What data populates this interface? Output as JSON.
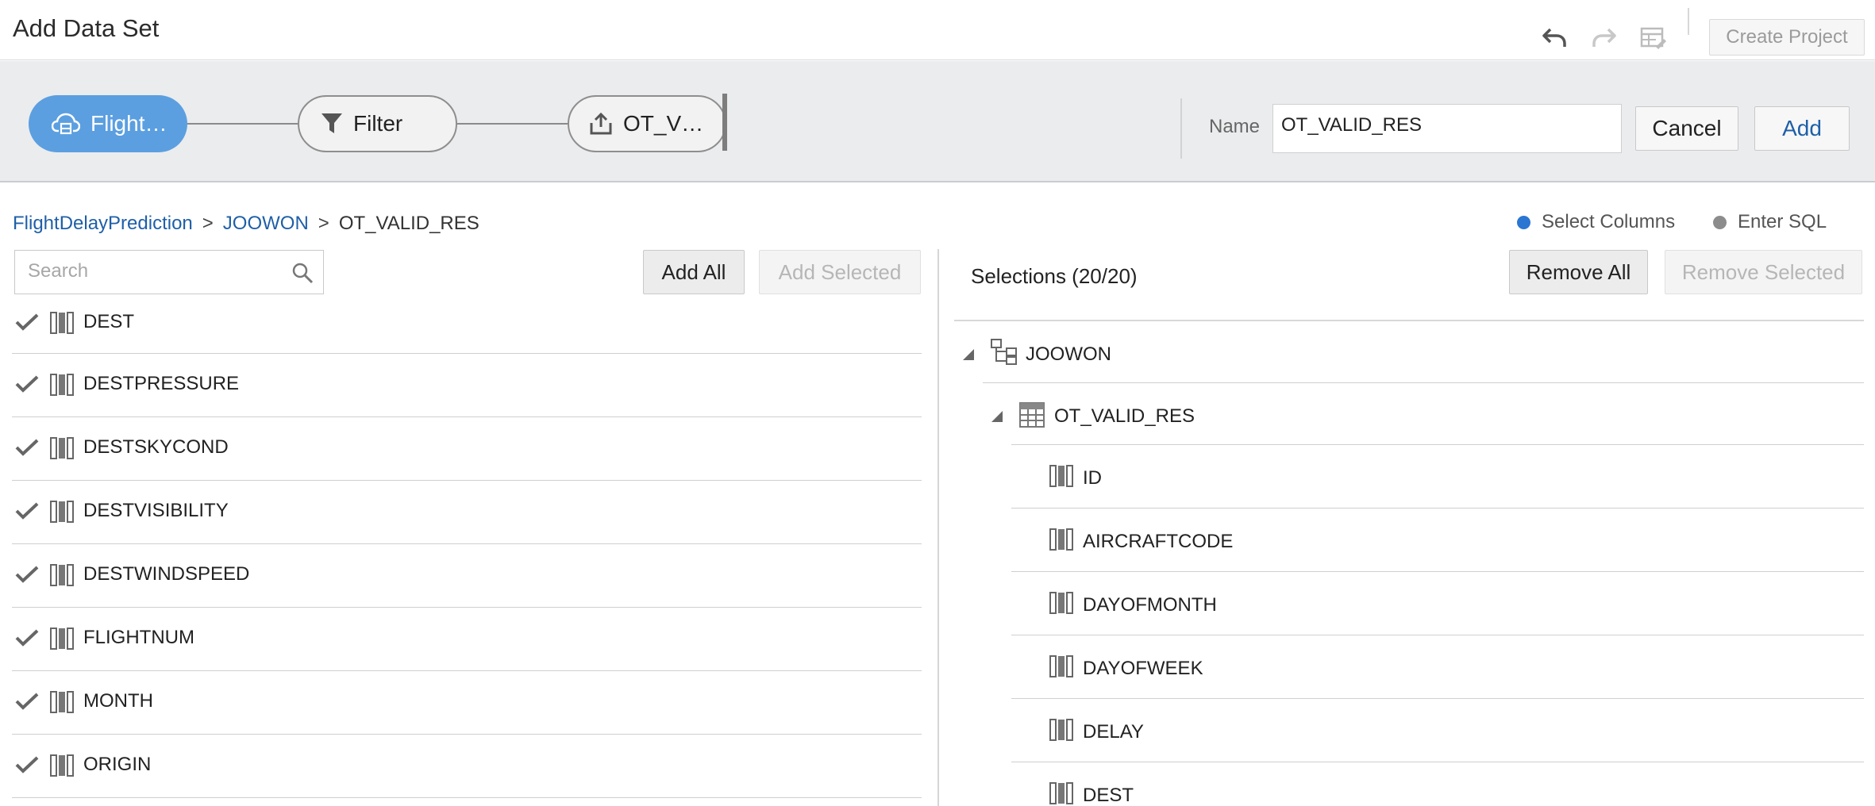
{
  "header": {
    "title": "Add Data Set",
    "icons": [
      "undo-icon",
      "redo-icon",
      "table-edit-icon"
    ],
    "create_project_label": "Create Project"
  },
  "flow": {
    "nodes": [
      {
        "label": "Flight…",
        "icon": "cloud-source-icon",
        "active": true
      },
      {
        "label": "Filter",
        "icon": "filter-icon",
        "active": false
      },
      {
        "label": "OT_V…",
        "icon": "export-icon",
        "active": false
      }
    ],
    "name_label": "Name",
    "name_value": "OT_VALID_RES",
    "cancel_label": "Cancel",
    "add_label": "Add"
  },
  "breadcrumb": {
    "items": [
      "FlightDelayPrediction",
      "JOOWON",
      "OT_VALID_RES"
    ],
    "separator": ">"
  },
  "mode": {
    "select_columns_label": "Select Columns",
    "enter_sql_label": "Enter SQL",
    "selected": "Select Columns",
    "colors": {
      "selected": "#2a76d2",
      "unselected": "#8c8c8c"
    }
  },
  "left_panel": {
    "search_placeholder": "Search",
    "add_all_label": "Add All",
    "add_selected_label": "Add Selected",
    "columns": [
      "DEST",
      "DESTPRESSURE",
      "DESTSKYCOND",
      "DESTVISIBILITY",
      "DESTWINDSPEED",
      "FLIGHTNUM",
      "MONTH",
      "ORIGIN"
    ]
  },
  "right_panel": {
    "selections_label": "Selections (20/20)",
    "remove_all_label": "Remove All",
    "remove_selected_label": "Remove Selected",
    "schema": "JOOWON",
    "table": "OT_VALID_RES",
    "columns": [
      "ID",
      "AIRCRAFTCODE",
      "DAYOFMONTH",
      "DAYOFWEEK",
      "DELAY",
      "DEST"
    ]
  },
  "colors": {
    "accent_blue": "#5b9fe0",
    "link_blue": "#1f5fa8"
  }
}
